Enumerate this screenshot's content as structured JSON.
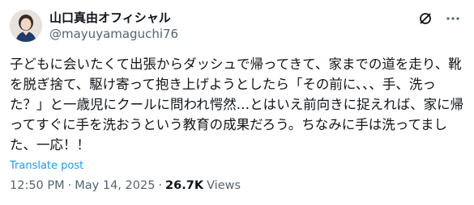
{
  "author": {
    "display_name": "山口真由オフィシャル",
    "handle": "@mayuyamaguchi76"
  },
  "icons": {
    "avatar": "avatar",
    "grok": "grok-icon",
    "more": "more-icon"
  },
  "tweet": {
    "text": "子どもに会いたくて出張からダッシュで帰ってきて、家までの道を走り、靴を脱ぎ捨て、駆け寄って抱き上げようとしたら「その前に、、、手、洗った？」と一歳児にクールに問われ愕然…とはいえ前向きに捉えれば、家に帰ってすぐに手を洗おうという教育の成果だろう。ちなみに手は洗ってました、一応！！",
    "translate_label": "Translate post"
  },
  "meta": {
    "time": "12:50 PM",
    "separator": "·",
    "date": "May 14, 2025",
    "views_count": "26.7K",
    "views_label": "Views"
  },
  "colors": {
    "text": "#0f1419",
    "secondary": "#536471",
    "link": "#1d9bf0"
  }
}
